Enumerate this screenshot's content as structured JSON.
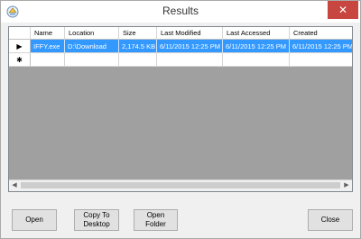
{
  "window": {
    "title": "Results",
    "close_glyph": "✕"
  },
  "table": {
    "columns": [
      "Name",
      "Location",
      "Size",
      "Last Modified",
      "Last Accessed",
      "Created"
    ],
    "rows": [
      {
        "selected": true,
        "indicator": "▶",
        "cells": [
          "IFFY.exe",
          "D:\\Download",
          "2,174.5 KB",
          "6/11/2015 12:25 PM",
          "6/11/2015 12:25 PM",
          "6/11/2015 12:25 PM"
        ]
      },
      {
        "new_row": true,
        "indicator": "✱",
        "cells": [
          "",
          "",
          "",
          "",
          "",
          ""
        ]
      }
    ]
  },
  "buttons": {
    "open": "Open",
    "copy_to_desktop": "Copy To\nDesktop",
    "open_folder": "Open\nFolder",
    "close": "Close"
  },
  "colors": {
    "selection": "#3399ff",
    "close_button": "#c7463f",
    "grid_background": "#a0a0a0"
  }
}
